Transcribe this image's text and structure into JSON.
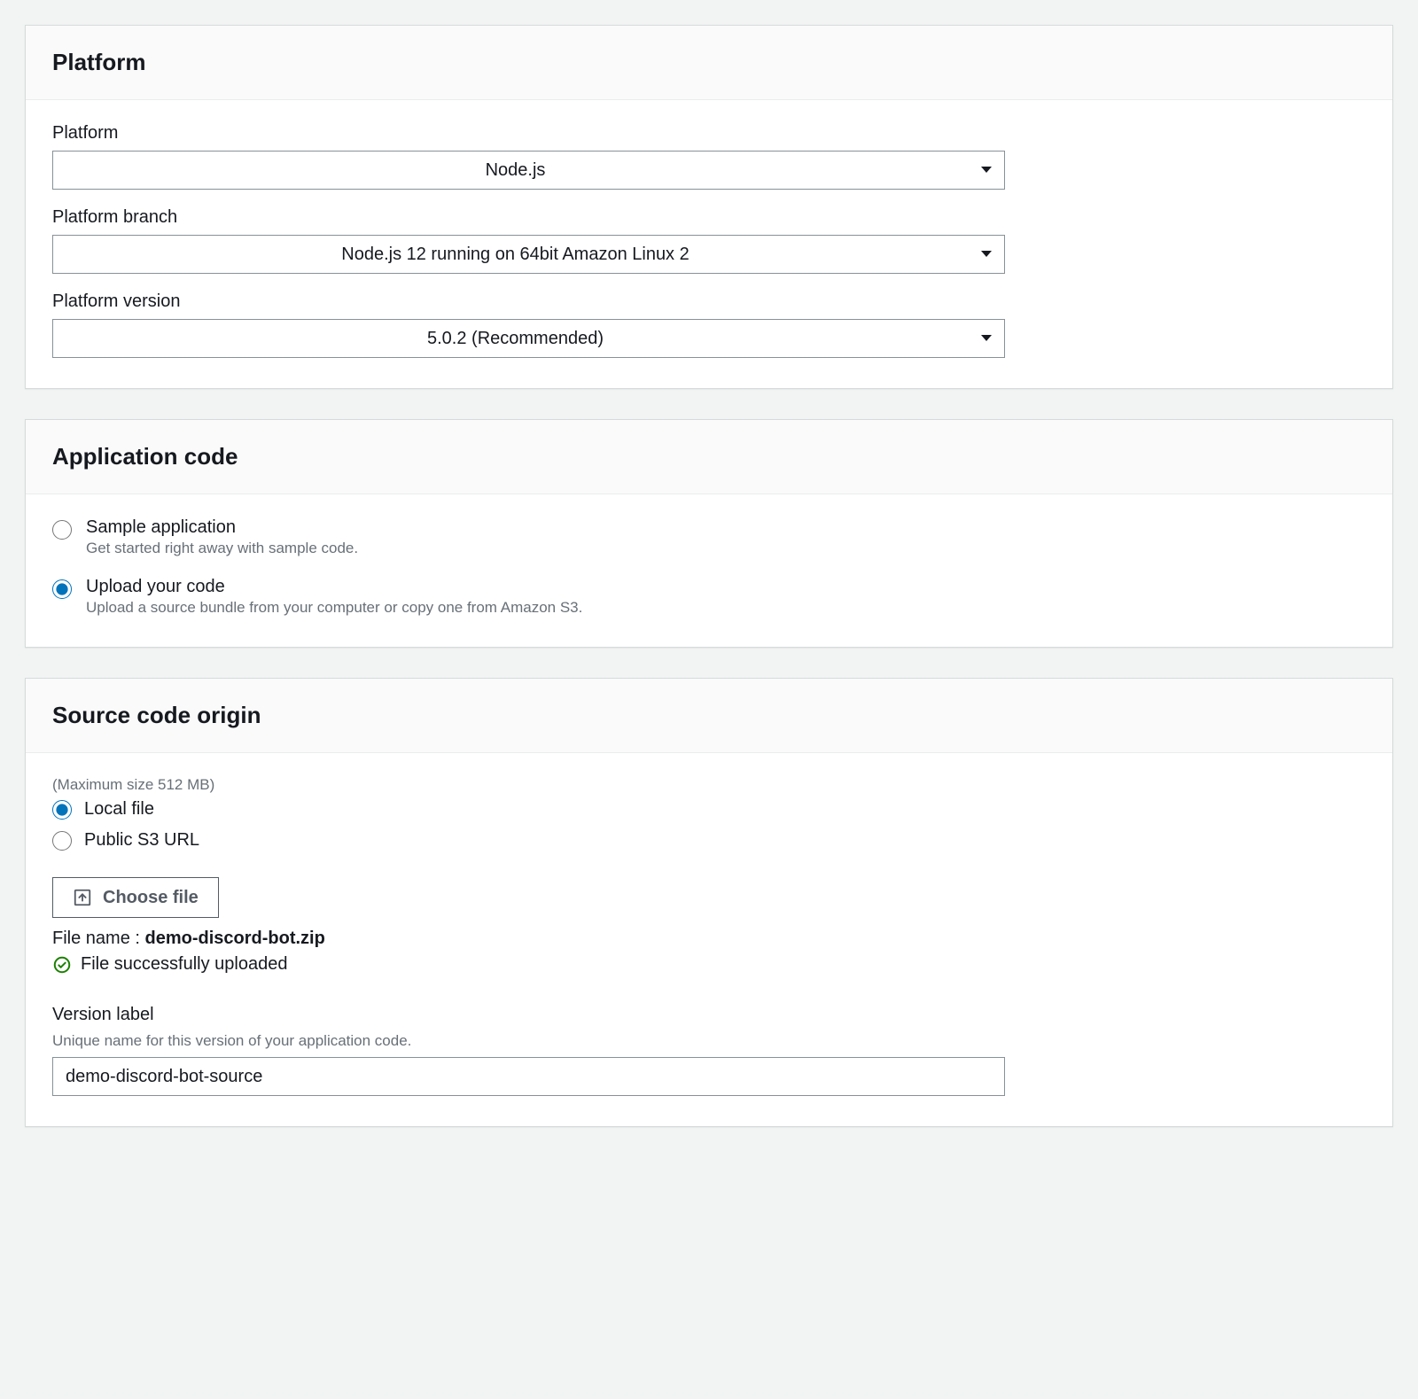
{
  "platform": {
    "title": "Platform",
    "fields": {
      "platform": {
        "label": "Platform",
        "value": "Node.js"
      },
      "branch": {
        "label": "Platform branch",
        "value": "Node.js 12 running on 64bit Amazon Linux 2"
      },
      "version": {
        "label": "Platform version",
        "value": "5.0.2 (Recommended)"
      }
    }
  },
  "app_code": {
    "title": "Application code",
    "options": {
      "sample": {
        "label": "Sample application",
        "desc": "Get started right away with sample code."
      },
      "upload": {
        "label": "Upload your code",
        "desc": "Upload a source bundle from your computer or copy one from Amazon S3."
      }
    }
  },
  "source_origin": {
    "title": "Source code origin",
    "max_size": "(Maximum size 512 MB)",
    "options": {
      "local": {
        "label": "Local file"
      },
      "s3": {
        "label": "Public S3 URL"
      }
    },
    "choose_file_label": "Choose file",
    "file_name_label": "File name : ",
    "file_name_value": "demo-discord-bot.zip",
    "upload_success": "File successfully uploaded",
    "version": {
      "label": "Version label",
      "help": "Unique name for this version of your application code.",
      "value": "demo-discord-bot-source"
    }
  }
}
